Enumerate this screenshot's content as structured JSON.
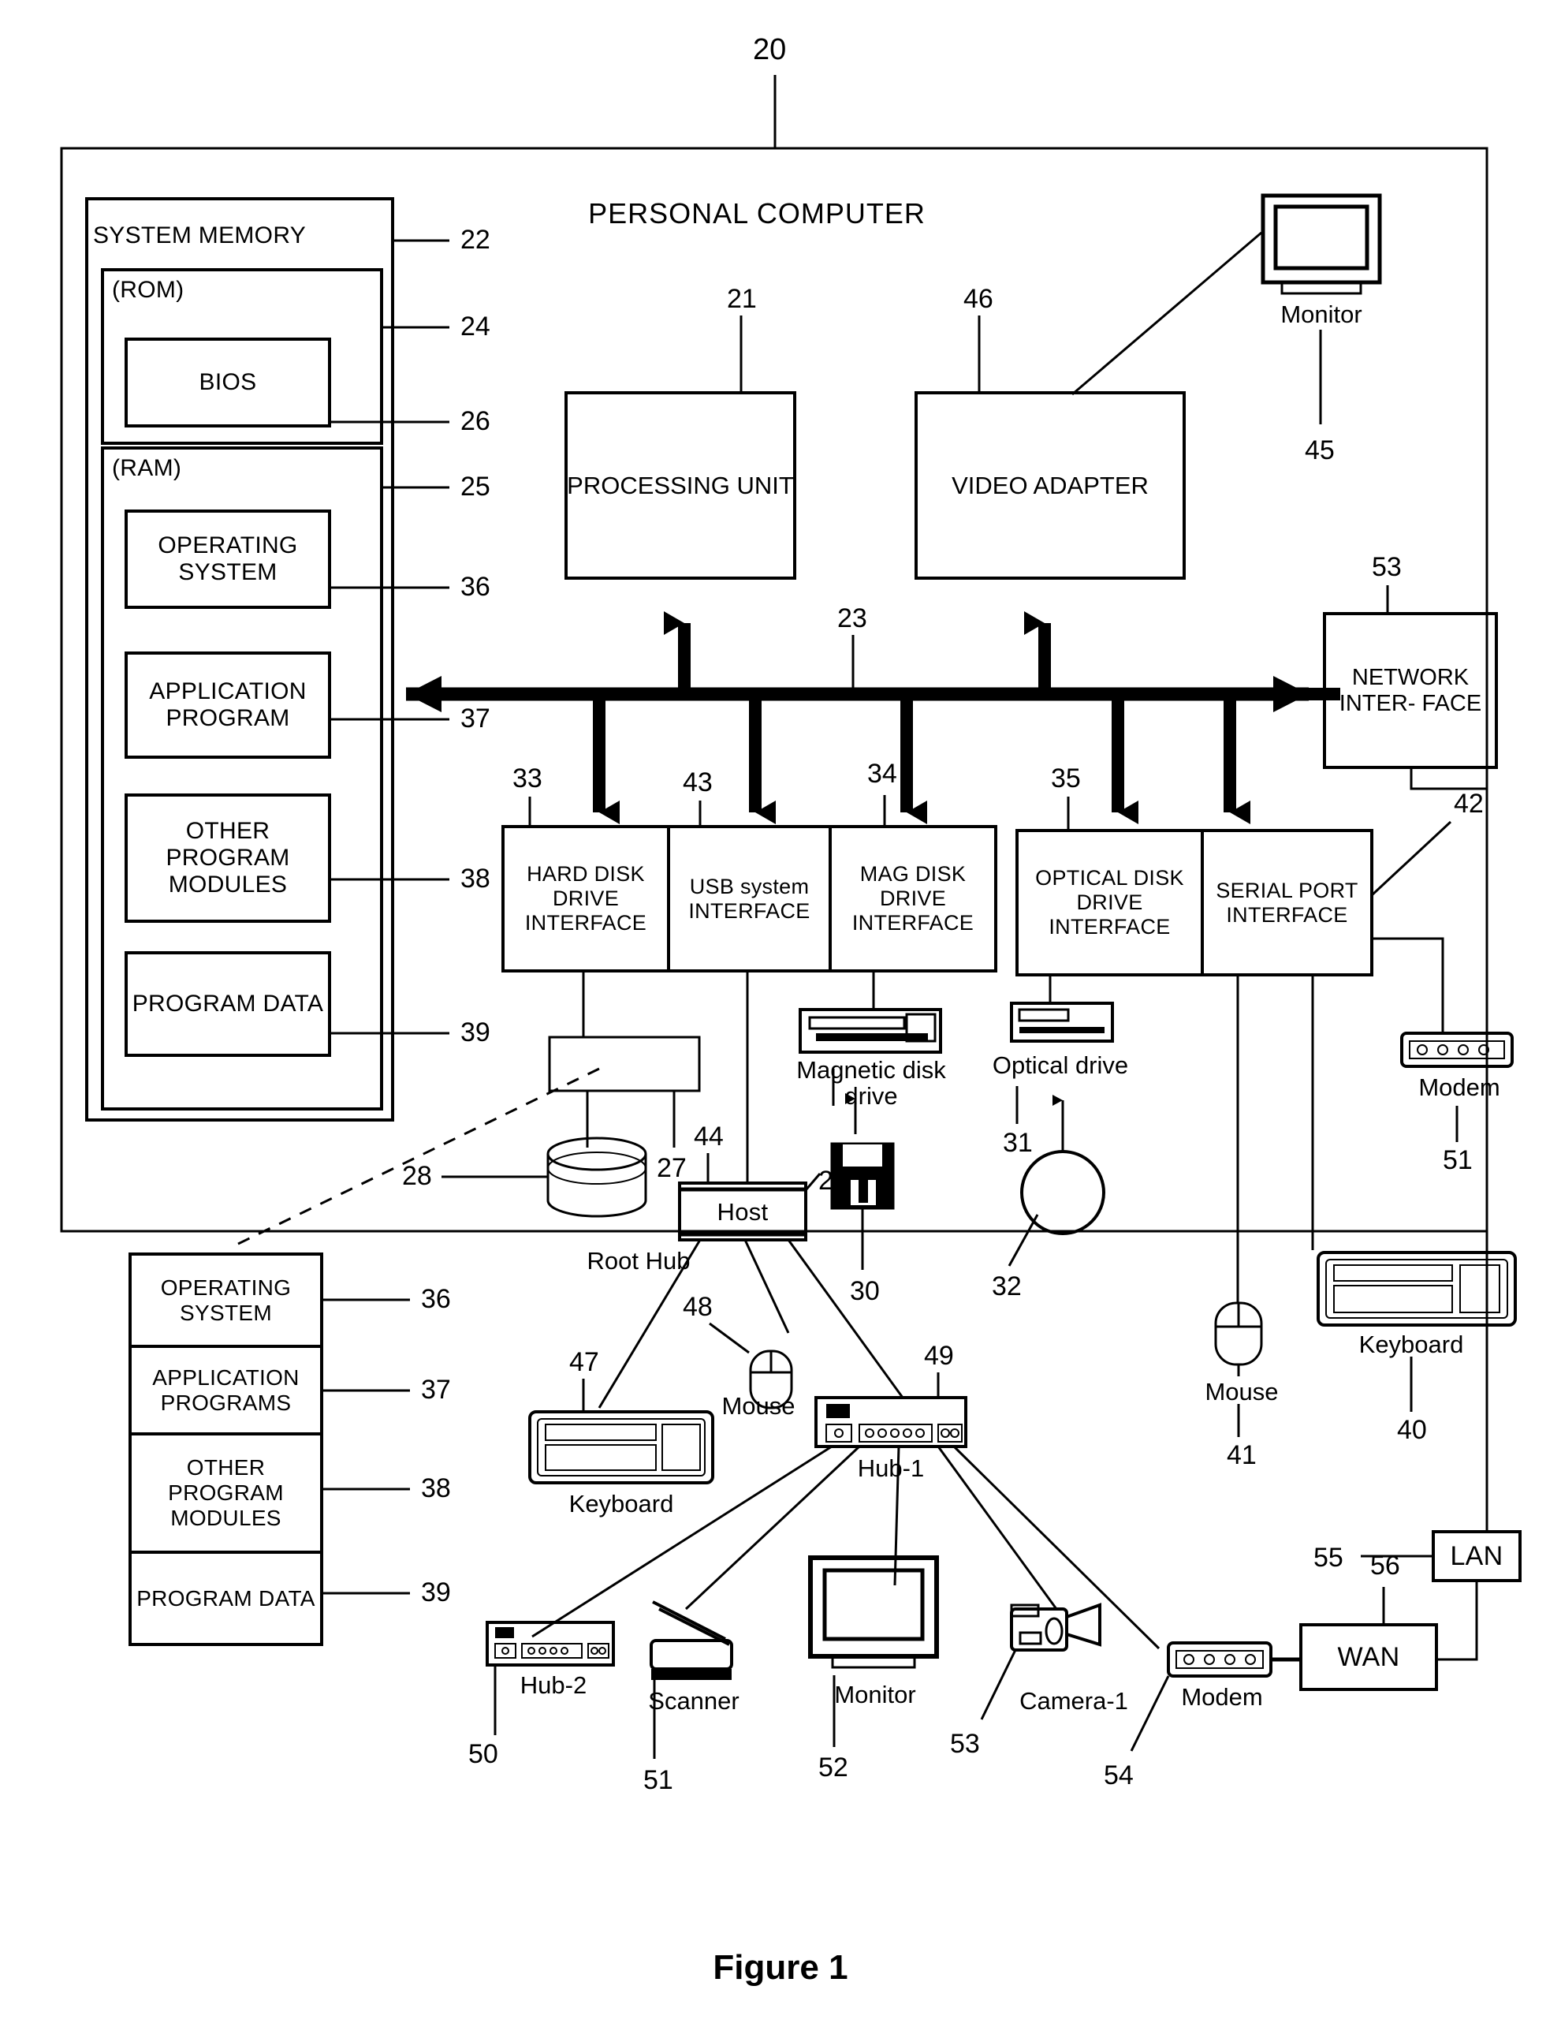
{
  "figure": {
    "caption": "Figure 1",
    "top_ref": "20"
  },
  "outer": {
    "title": "PERSONAL COMPUTER"
  },
  "system_memory": {
    "label": "SYSTEM MEMORY",
    "ref": "22",
    "rom": {
      "label": "(ROM)",
      "ref": "24",
      "items": [
        {
          "label": "BIOS",
          "ref": "26"
        }
      ]
    },
    "ram": {
      "label": "(RAM)",
      "ref": "25",
      "items": [
        {
          "label": "OPERATING\nSYSTEM",
          "ref": "36"
        },
        {
          "label": "APPLICATION\nPROGRAM",
          "ref": "37"
        },
        {
          "label": "OTHER\nPROGRAM\nMODULES",
          "ref": "38"
        },
        {
          "label": "PROGRAM\nDATA",
          "ref": "39"
        }
      ]
    }
  },
  "core": {
    "processing_unit": {
      "label": "PROCESSING\nUNIT",
      "ref": "21"
    },
    "video_adapter": {
      "label": "VIDEO\nADAPTER",
      "ref": "46"
    },
    "network_interface": {
      "label": "NETWORK\nINTER-\nFACE",
      "ref": "53"
    },
    "bus": {
      "ref": "23"
    },
    "monitor": {
      "label": "Monitor",
      "ref": "45"
    }
  },
  "interfaces": [
    {
      "label": "HARD DISK\nDRIVE\nINTERFACE",
      "ref": "33"
    },
    {
      "label": "USB system\nINTERFACE",
      "ref": "43"
    },
    {
      "label": "MAG DISK\nDRIVE\nINTERFACE",
      "ref": "34"
    },
    {
      "label": "OPTICAL\nDISK DRIVE\nINTERFACE",
      "ref": "35"
    },
    {
      "label": "SERIAL\nPORT\nINTERFACE",
      "ref": "42"
    }
  ],
  "internal_devices": [
    {
      "name": "hard-disk-drive",
      "label": "",
      "ref": "27"
    },
    {
      "name": "hard-disk-platter",
      "label": "",
      "ref": "28"
    },
    {
      "name": "magnetic-disk-drive",
      "label": "Magnetic disk\ndrive",
      "ref": "29"
    },
    {
      "name": "floppy-disk",
      "label": "",
      "ref": "30"
    },
    {
      "name": "optical-drive",
      "label": "Optical drive",
      "ref": "31"
    },
    {
      "name": "optical-disc",
      "label": "",
      "ref": "32"
    }
  ],
  "serial_devices": [
    {
      "label": "Mouse",
      "ref": "41"
    },
    {
      "label": "Keyboard",
      "ref": "40"
    },
    {
      "label": "Modem",
      "ref": "51"
    }
  ],
  "usb_tree": {
    "host": {
      "label": "Host",
      "ref": "44"
    },
    "root_hub": {
      "label": "Root Hub"
    },
    "devices": [
      {
        "label": "Keyboard",
        "ref": "47"
      },
      {
        "label": "Mouse",
        "ref": "48"
      },
      {
        "label": "Hub-1",
        "ref": "49"
      },
      {
        "label": "Hub-2",
        "ref": "50"
      },
      {
        "label": "Scanner",
        "ref": "51"
      },
      {
        "label": "Monitor",
        "ref": "52"
      },
      {
        "label": "Camera-1",
        "ref": "53"
      },
      {
        "label": "Modem",
        "ref": "54"
      }
    ]
  },
  "network": {
    "lan": {
      "label": "LAN",
      "ref": "55"
    },
    "wan": {
      "label": "WAN",
      "ref": "56"
    }
  },
  "remote_memory": {
    "items": [
      {
        "label": "OPERATING\nSYSTEM",
        "ref": "36"
      },
      {
        "label": "APPLICATION\nPROGRAMS",
        "ref": "37"
      },
      {
        "label": "OTHER\nPROGRAM\nMODULES",
        "ref": "38"
      },
      {
        "label": "PROGRAM\nDATA",
        "ref": "39"
      }
    ]
  }
}
